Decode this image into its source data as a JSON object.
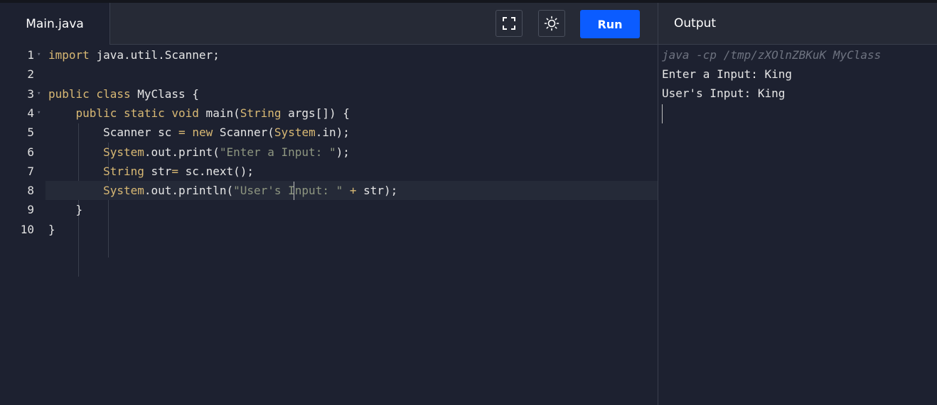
{
  "editor": {
    "tab_label": "Main.java",
    "toolbar": {
      "fullscreen_icon": "fullscreen-icon",
      "theme_icon": "sun-icon",
      "run_label": "Run",
      "run_color": "#0b5cff"
    },
    "lines": [
      {
        "num": "1",
        "parts": [
          [
            "kw",
            "import"
          ],
          [
            "",
            "java.util.Scanner;"
          ]
        ]
      },
      {
        "num": "2",
        "parts": []
      },
      {
        "num": "3",
        "parts": [
          [
            "kw",
            "public class"
          ],
          [
            "",
            "MyClass {"
          ]
        ]
      },
      {
        "num": "4",
        "parts": [
          [
            "",
            "    "
          ],
          [
            "kw",
            "public static void"
          ],
          [
            "",
            " main("
          ],
          [
            "kw",
            "String"
          ],
          [
            "",
            " args[]) {"
          ]
        ]
      },
      {
        "num": "5",
        "parts": [
          [
            "",
            "        Scanner sc "
          ],
          [
            "op",
            "="
          ],
          [
            "",
            " "
          ],
          [
            "kw",
            "new"
          ],
          [
            "",
            " Scanner("
          ],
          [
            "kw",
            "System"
          ],
          [
            "",
            ".in);"
          ]
        ]
      },
      {
        "num": "6",
        "parts": [
          [
            "",
            "        "
          ],
          [
            "kw",
            "System"
          ],
          [
            "",
            ".out.print("
          ],
          [
            "str",
            "\"Enter a Input: \""
          ],
          [
            "",
            ");"
          ]
        ]
      },
      {
        "num": "7",
        "parts": [
          [
            "",
            "        "
          ],
          [
            "kw",
            "String"
          ],
          [
            "",
            " str"
          ],
          [
            "op",
            "="
          ],
          [
            "",
            " sc.next();"
          ]
        ]
      },
      {
        "num": "8",
        "parts": [
          [
            "",
            "        "
          ],
          [
            "kw",
            "System"
          ],
          [
            "",
            ".out.println("
          ],
          [
            "str",
            "\"User's Input: \""
          ],
          [
            "",
            " "
          ],
          [
            "op",
            "+"
          ],
          [
            "",
            " str);"
          ]
        ]
      },
      {
        "num": "9",
        "parts": [
          [
            "",
            "    }"
          ]
        ]
      },
      {
        "num": "10",
        "parts": [
          [
            "",
            "}"
          ]
        ]
      }
    ]
  },
  "output": {
    "title": "Output",
    "command": "java -cp /tmp/zXOlnZBKuK MyClass",
    "lines": [
      "Enter a Input: King",
      "User's Input: King"
    ]
  },
  "colors": {
    "background": "#1d2130",
    "header": "#262a36",
    "keyword": "#d9b974",
    "string": "#8e9680"
  }
}
